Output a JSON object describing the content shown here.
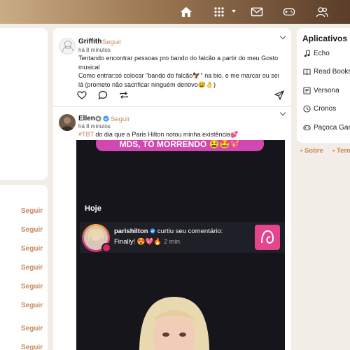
{
  "topbar": {
    "icons": [
      "home-icon",
      "apps-grid-icon",
      "mail-icon",
      "gamepad-icon",
      "people-icon"
    ]
  },
  "left_panel": {
    "follow_label": "Seguir"
  },
  "posts": [
    {
      "author": "Griffith",
      "follow": "Seguir",
      "time": "há 8 minutos",
      "body": [
        "Tentando encontrar pessoas pro bando do falcão a partir do meu Gosto musical",
        "Como entrar:só colocar \"bando do falcão🦅\" na bio, e me marcar ou sei lá (prometo não sacrificar ninguém denovo😅👌)"
      ]
    },
    {
      "author": "Ellen",
      "follow": "Seguir",
      "time": "há 8 minutos",
      "hashtag": "#TBT",
      "body_rest": " do dia que a Paris Hilton notou minha existência💕",
      "media": {
        "banner": "MDS, TÔ MORRENDO 😫🤩💖",
        "today_label": "Hoje",
        "notification_user": "parishilton",
        "notification_action": " curtiu seu comentário:",
        "notification_comment": "Finally! 😍💖🔥",
        "notification_time": "2 min"
      }
    }
  ],
  "sidebar": {
    "title": "Aplicativos",
    "items": [
      {
        "label": "Echo",
        "icon": "music-note-icon"
      },
      {
        "label": "Read Books",
        "icon": "book-icon"
      },
      {
        "label": "Versona",
        "icon": "quote-box-icon"
      },
      {
        "label": "Cronos",
        "icon": "clock-icon"
      },
      {
        "label": "Paçoca Games",
        "icon": "gamepad-icon"
      }
    ]
  },
  "footer": {
    "links": [
      "• Sobre",
      "• Termos"
    ]
  },
  "colors": {
    "accent": "#c8875a",
    "topbar_start": "#c9ac86",
    "topbar_end": "#5a3e2a",
    "page_bg": "#f2ede6"
  }
}
